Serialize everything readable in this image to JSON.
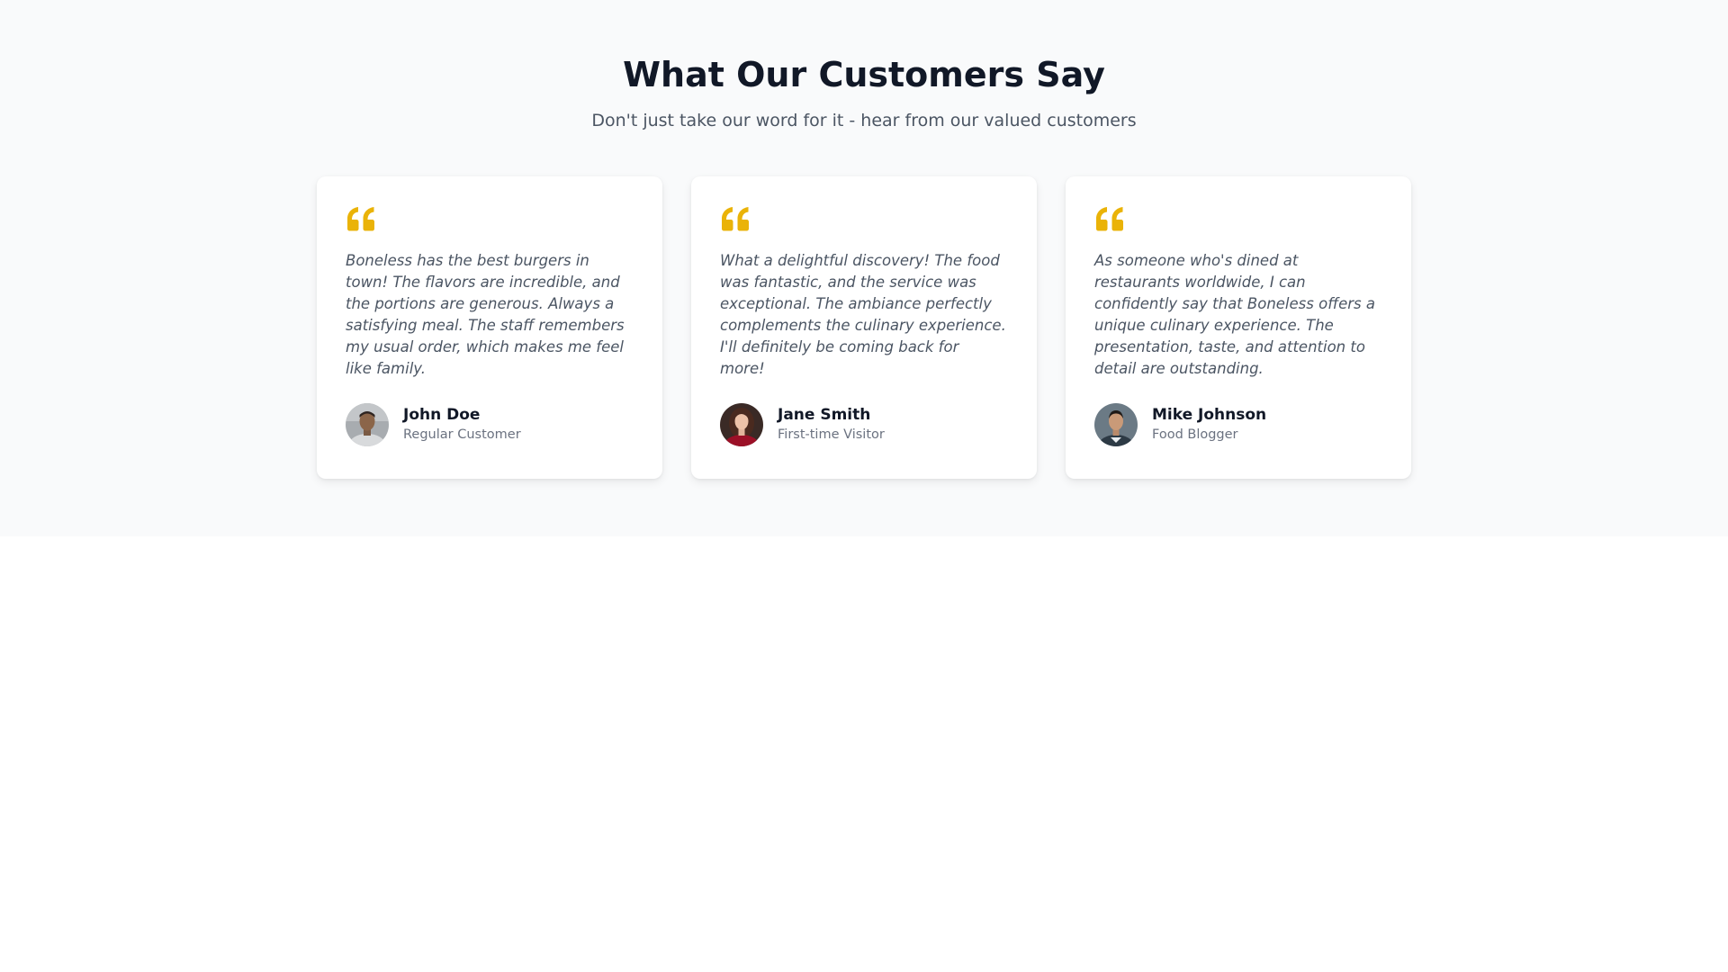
{
  "section": {
    "title": "What Our Customers Say",
    "subtitle": "Don't just take our word for it - hear from our valued customers"
  },
  "colors": {
    "accent": "#eab308",
    "background": "#f9fafb",
    "heading": "#111827",
    "text": "#4b5563"
  },
  "testimonials": [
    {
      "icon": "quote-icon",
      "quote": "Boneless has the best burgers in town! The flavors are incredible, and the portions are generous. Always a satisfying meal. The staff remembers my usual order, which makes me feel like family.",
      "name": "John Doe",
      "role": "Regular Customer"
    },
    {
      "icon": "quote-icon",
      "quote": "What a delightful discovery! The food was fantastic, and the service was exceptional. The ambiance perfectly complements the culinary experience. I'll definitely be coming back for more!",
      "name": "Jane Smith",
      "role": "First-time Visitor"
    },
    {
      "icon": "quote-icon",
      "quote": "As someone who's dined at restaurants worldwide, I can confidently say that Boneless offers a unique culinary experience. The presentation, taste, and attention to detail are outstanding.",
      "name": "Mike Johnson",
      "role": "Food Blogger"
    }
  ]
}
